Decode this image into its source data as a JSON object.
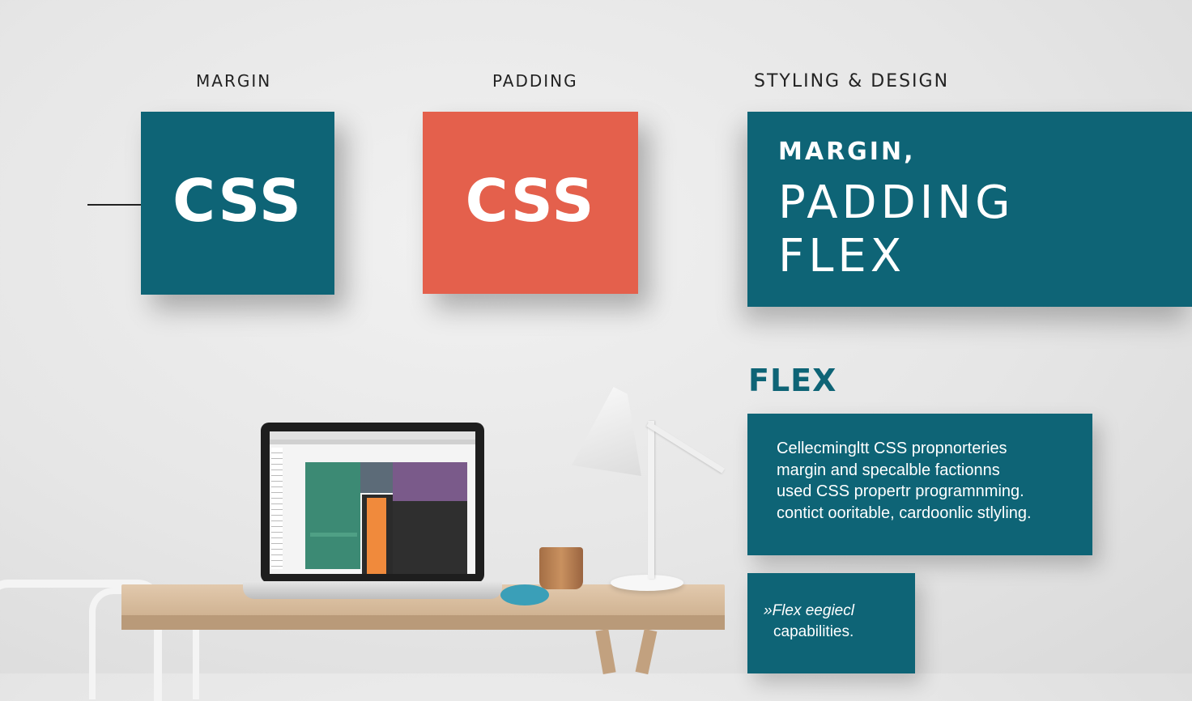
{
  "columns": {
    "margin_label": "MARGIN",
    "padding_label": "PADDING",
    "styling_label": "STYLING & DESIGN"
  },
  "cards": {
    "margin_card_text": "CSS",
    "padding_card_text": "CSS",
    "title_line1": "MARGIN,",
    "title_line2": "PADDING",
    "title_line3": "FLEX"
  },
  "flex_section": {
    "heading": "FLEX",
    "description_lines": [
      "Cellecmingltt CSS propnorteries",
      "margin and specalble factionns",
      "used  CSS propertr programnming.",
      "contict ooritable, cardoonlic stlyling."
    ],
    "note_lines": [
      "»Flex eegiecl",
      "capabilities."
    ]
  },
  "colors": {
    "teal": "#0e6476",
    "coral": "#e4604c",
    "background": "#e8e8e8"
  }
}
